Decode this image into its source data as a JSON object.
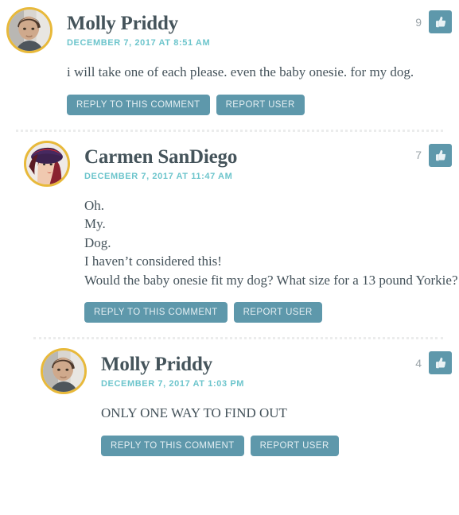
{
  "theme": {
    "accent_teal": "#5e98ab",
    "date_color": "#6dc5cc",
    "avatar_ring": "#e8b93a",
    "text_color": "#44525a",
    "divider_color": "#ebecec",
    "vote_count_color": "#9aa3a8"
  },
  "comments": [
    {
      "author": "Molly Priddy",
      "date": "DECEMBER 7, 2017 AT 8:51 AM",
      "vote_count": "9",
      "vote_icon": "thumbs-up-icon",
      "avatar": "molly-priddy-avatar",
      "body": [
        "i will take one of each please. even the baby onesie. for my dog."
      ],
      "reply_label": "REPLY TO THIS COMMENT",
      "report_label": "REPORT USER",
      "level": 0
    },
    {
      "author": "Carmen SanDiego",
      "date": "DECEMBER 7, 2017 AT 11:47 AM",
      "vote_count": "7",
      "vote_icon": "thumbs-up-icon",
      "avatar": "carmen-sandiego-avatar",
      "body": [
        "Oh.",
        "My.",
        "Dog.",
        "I haven’t considered this!",
        "Would the baby onesie fit my dog? What size for a 13 pound Yorkie?"
      ],
      "reply_label": "REPLY TO THIS COMMENT",
      "report_label": "REPORT USER",
      "level": 1
    },
    {
      "author": "Molly Priddy",
      "date": "DECEMBER 7, 2017 AT 1:03 PM",
      "vote_count": "4",
      "vote_icon": "thumbs-up-icon",
      "avatar": "molly-priddy-avatar",
      "body": [
        "ONLY ONE WAY TO FIND OUT"
      ],
      "reply_label": "REPLY TO THIS COMMENT",
      "report_label": "REPORT USER",
      "level": 2
    }
  ]
}
